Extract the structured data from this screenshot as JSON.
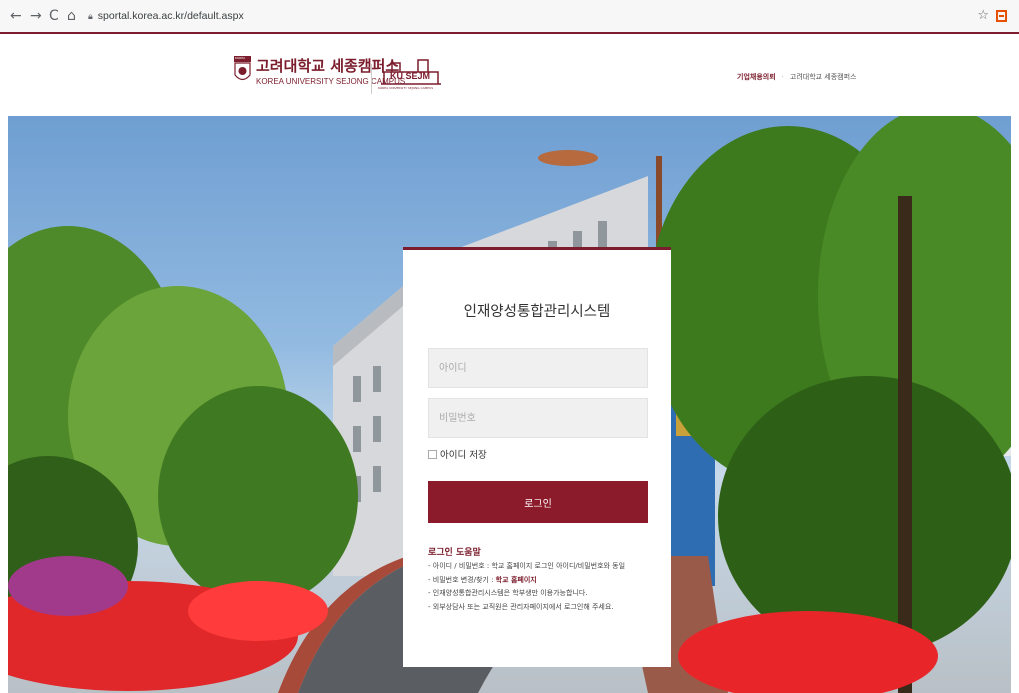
{
  "browser": {
    "back": "←",
    "forward": "→",
    "reload": "C",
    "home": "⌂",
    "url": "sportal.korea.ac.kr/default.aspx",
    "bookmark": "☆"
  },
  "header": {
    "univ_name_kr": "고려대학교 세종캠퍼스",
    "univ_name_en": "KOREA UNIVERSITY SEJONG CAMPUS",
    "seal_text": "KOREA",
    "ku_sejm": "KU SEJM",
    "ku_sejm_sub": "KOREA UNIVERSITY SEJONG CAMPUS",
    "link_corporate": "기업채용의뢰",
    "link_separator": "·",
    "link_campus": "고려대학교 세종캠퍼스"
  },
  "login": {
    "title": "인재양성통합관리시스템",
    "id_placeholder": "아이디",
    "pw_placeholder": "비밀번호",
    "save_id_label": "아이디 저장",
    "login_button": "로그인",
    "help_title": "로그인 도움말",
    "help_items": {
      "item1": "- 아이디 / 비밀번호 : 학교 홈페이지 로그인 아이디/비밀번호와 동일",
      "item2_prefix": "- 비밀번호 변경/찾기 : ",
      "item2_link": "학교 홈페이지",
      "item3": "- 인재양성통합관리시스템은 학부생만 이용가능합니다.",
      "item4": "- 외부상담사 또는 교직원은 관리자페이지에서 로그인해 주세요."
    }
  },
  "colors": {
    "brand": "#7b1d2c",
    "button": "#8b1a2a"
  }
}
